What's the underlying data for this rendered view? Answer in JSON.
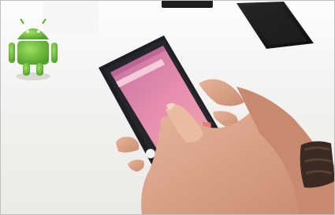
{
  "scene": {
    "subject": "photo",
    "objects": [
      {
        "name": "android-figurine",
        "color": "#6fbf3a"
      },
      {
        "name": "smartphone",
        "color": "#1e1f24"
      },
      {
        "name": "phone-screen",
        "color": "#e58fb0"
      },
      {
        "name": "hand",
        "color": "#d9a487"
      },
      {
        "name": "wrist-bracelet",
        "color": "#3a2a22"
      },
      {
        "name": "background-phone",
        "color": "#141414"
      }
    ],
    "colors": {
      "table": "#f2f1ef",
      "wall": "#fbfbfb",
      "border": "#bfbfbf"
    }
  }
}
